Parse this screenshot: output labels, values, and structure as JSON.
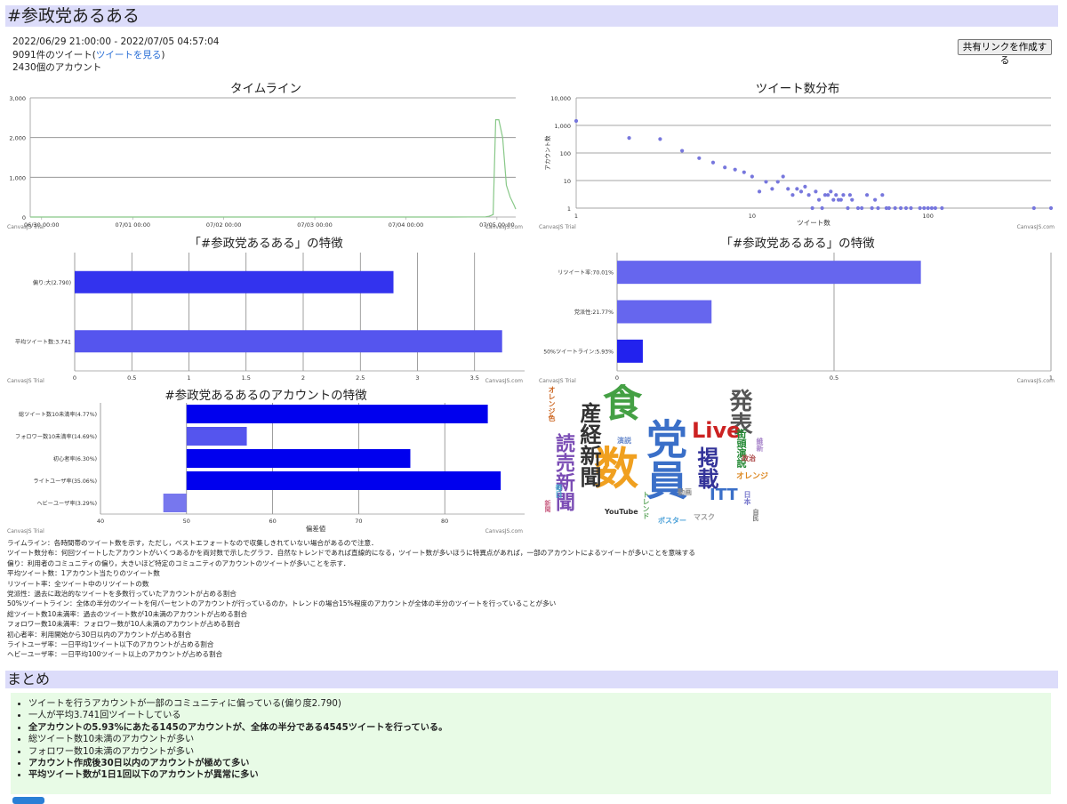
{
  "page": {
    "title": "#参政党あるある",
    "date_range": "2022/06/29 21:00:00 - 2022/07/05 04:57:04",
    "tweet_count_prefix": "9091件のツイート(",
    "tweet_link": "ツイートを見る",
    "tweet_count_suffix": ")",
    "account_count": "2430個のアカウント",
    "share_button": "共有リンクを作成する"
  },
  "trial_label": "CanvasJS Trial",
  "brand_label": "CanvasJS.com",
  "chart_data": [
    {
      "id": "timeline",
      "type": "line",
      "title": "タイムライン",
      "x_ticks": [
        "06/30 00:00",
        "07/01 00:00",
        "07/02 00:00",
        "07/03 00:00",
        "07/04 00:00",
        "07/05 00:00"
      ],
      "y_ticks": [
        "0",
        "1,000",
        "2,000",
        "3,000"
      ],
      "ylim": [
        0,
        3000
      ],
      "grid": true,
      "x": [
        "06/29 21:00",
        "06/30 12:00",
        "07/01 12:00",
        "07/02 12:00",
        "07/03 12:00",
        "07/04 12:00",
        "07/04 21:00",
        "07/04 22:00",
        "07/04 23:00",
        "07/04 23:40",
        "07/05 00:30",
        "07/05 01:30",
        "07/05 02:30",
        "07/05 03:30",
        "07/05 04:30",
        "07/05 04:57"
      ],
      "values": [
        0,
        0,
        0,
        0,
        0,
        0,
        5,
        20,
        60,
        2450,
        2450,
        2000,
        800,
        500,
        300,
        200
      ],
      "color": "#88c888"
    },
    {
      "id": "distribution",
      "type": "scatter",
      "title": "ツイート数分布",
      "xlabel": "ツイート数",
      "ylabel": "アカウント数",
      "x_scale": "log",
      "y_scale": "log",
      "x_ticks": [
        "1",
        "10",
        "100"
      ],
      "y_ticks": [
        "1",
        "10",
        "100",
        "1,000",
        "10,000"
      ],
      "xlim": [
        1,
        500
      ],
      "ylim": [
        1,
        10000
      ],
      "color": "#7777dd",
      "points": [
        [
          1,
          1450
        ],
        [
          2,
          350
        ],
        [
          3,
          320
        ],
        [
          4,
          120
        ],
        [
          5,
          65
        ],
        [
          6,
          45
        ],
        [
          7,
          30
        ],
        [
          8,
          25
        ],
        [
          9,
          20
        ],
        [
          10,
          14
        ],
        [
          11,
          4
        ],
        [
          12,
          9
        ],
        [
          13,
          5
        ],
        [
          14,
          9
        ],
        [
          15,
          14
        ],
        [
          16,
          5
        ],
        [
          17,
          3
        ],
        [
          18,
          5
        ],
        [
          19,
          4
        ],
        [
          20,
          6
        ],
        [
          21,
          3
        ],
        [
          22,
          1
        ],
        [
          23,
          4
        ],
        [
          24,
          2
        ],
        [
          25,
          1
        ],
        [
          26,
          3
        ],
        [
          27,
          3
        ],
        [
          28,
          4
        ],
        [
          29,
          2
        ],
        [
          30,
          3
        ],
        [
          31,
          2
        ],
        [
          32,
          2
        ],
        [
          33,
          3
        ],
        [
          35,
          1
        ],
        [
          36,
          3
        ],
        [
          37,
          2
        ],
        [
          40,
          1
        ],
        [
          42,
          1
        ],
        [
          45,
          3
        ],
        [
          48,
          1
        ],
        [
          50,
          2
        ],
        [
          52,
          1
        ],
        [
          55,
          3
        ],
        [
          58,
          1
        ],
        [
          60,
          1
        ],
        [
          65,
          1
        ],
        [
          70,
          1
        ],
        [
          75,
          1
        ],
        [
          80,
          1
        ],
        [
          90,
          1
        ],
        [
          95,
          1
        ],
        [
          100,
          1
        ],
        [
          105,
          1
        ],
        [
          110,
          1
        ],
        [
          120,
          1
        ],
        [
          400,
          1
        ],
        [
          500,
          1
        ]
      ]
    },
    {
      "id": "features1",
      "type": "bar",
      "orientation": "horizontal",
      "title": "「#参政党あるある」の特徴",
      "categories": [
        "偏り:大(2.790)",
        "平均ツイート数:3.741"
      ],
      "values": [
        2.79,
        3.741
      ],
      "colors": [
        "#3333ee",
        "#5555ee"
      ],
      "xlim": [
        0,
        4
      ],
      "x_ticks": [
        "0",
        "0.5",
        "1",
        "1.5",
        "2",
        "2.5",
        "3",
        "3.5",
        "4"
      ]
    },
    {
      "id": "features2",
      "type": "bar",
      "orientation": "horizontal",
      "title": "「#参政党あるある」の特徴",
      "categories": [
        "リツイート率:70.01%",
        "党派性:21.77%",
        "50%ツイートライン:5.93%"
      ],
      "values": [
        0.7001,
        0.2177,
        0.0593
      ],
      "colors": [
        "#6666ee",
        "#6666ee",
        "#2222ee"
      ],
      "xlim": [
        0,
        1
      ],
      "x_ticks": [
        "0",
        "0.5",
        "1"
      ]
    },
    {
      "id": "accounts",
      "type": "bar",
      "orientation": "horizontal",
      "title": "#参政党あるあるのアカウントの特徴",
      "xlabel": "偏差値",
      "categories": [
        "総ツイート数10未満率(4.77%)",
        "フォロワー数10未満率(14.69%)",
        "初心者率(6.30%)",
        "ライトユーザ率(35.06%)",
        "ヘビーユーザ率(3.29%)"
      ],
      "values": [
        85,
        57,
        76,
        86.5,
        47.3
      ],
      "colors": [
        "#0000ee",
        "#5555ee",
        "#0000ee",
        "#0000ee",
        "#7777ee"
      ],
      "base": 50,
      "xlim": [
        40,
        90
      ],
      "x_ticks": [
        "40",
        "50",
        "60",
        "70",
        "80",
        "90"
      ]
    }
  ],
  "wordcloud": [
    {
      "t": "数",
      "c": "#f0a020",
      "s": 50,
      "x": 58,
      "y": 70,
      "v": false
    },
    {
      "t": "党員",
      "c": "#3a6fc8",
      "s": 46,
      "x": 114,
      "y": 38,
      "v": true
    },
    {
      "t": "食",
      "c": "#44a044",
      "s": 44,
      "x": 68,
      "y": 0,
      "v": false
    },
    {
      "t": "産経新聞",
      "c": "#333333",
      "s": 24,
      "x": 40,
      "y": 20,
      "v": true
    },
    {
      "t": "読売新聞",
      "c": "#7b4db5",
      "s": 22,
      "x": 12,
      "y": 55,
      "v": true
    },
    {
      "t": "発表",
      "c": "#555555",
      "s": 26,
      "x": 208,
      "y": 5,
      "v": true
    },
    {
      "t": "掲載",
      "c": "#333399",
      "s": 24,
      "x": 172,
      "y": 70,
      "v": true
    },
    {
      "t": "Live",
      "c": "#cc2222",
      "s": 24,
      "x": 168,
      "y": 40,
      "v": false
    },
    {
      "t": "ITT",
      "c": "#3a6fc8",
      "s": 18,
      "x": 188,
      "y": 116,
      "v": false
    },
    {
      "t": "街頭演説",
      "c": "#228833",
      "s": 11,
      "x": 218,
      "y": 50,
      "v": true
    },
    {
      "t": "オレンジ",
      "c": "#dd8822",
      "s": 9,
      "x": 218,
      "y": 100,
      "v": false
    },
    {
      "t": "YouTube",
      "c": "#333333",
      "s": 8,
      "x": 70,
      "y": 140,
      "v": false
    },
    {
      "t": "動画",
      "c": "#888888",
      "s": 8,
      "x": 152,
      "y": 118,
      "v": false
    },
    {
      "t": "マスク",
      "c": "#999999",
      "s": 8,
      "x": 170,
      "y": 146,
      "v": false
    },
    {
      "t": "ポスター",
      "c": "#4aa0d8",
      "s": 8,
      "x": 130,
      "y": 150,
      "v": false
    },
    {
      "t": "トレンド",
      "c": "#66aa66",
      "s": 8,
      "x": 112,
      "y": 120,
      "v": true
    },
    {
      "t": "オレンジ色",
      "c": "#cc6622",
      "s": 8,
      "x": 6,
      "y": 2,
      "v": true
    },
    {
      "t": "政治",
      "c": "#aa4444",
      "s": 8,
      "x": 224,
      "y": 80,
      "v": false
    },
    {
      "t": "日本",
      "c": "#7777cc",
      "s": 8,
      "x": 226,
      "y": 120,
      "v": true
    },
    {
      "t": "維新",
      "c": "#aa88cc",
      "s": 8,
      "x": 240,
      "y": 60,
      "v": true
    },
    {
      "t": "自民",
      "c": "#777777",
      "s": 7,
      "x": 236,
      "y": 140,
      "v": true
    },
    {
      "t": "演説",
      "c": "#6688cc",
      "s": 8,
      "x": 84,
      "y": 60,
      "v": false
    },
    {
      "t": "毎日",
      "c": "#44aacc",
      "s": 8,
      "x": 14,
      "y": 112,
      "v": true
    },
    {
      "t": "新聞",
      "c": "#cc6688",
      "s": 7,
      "x": 2,
      "y": 130,
      "v": true
    }
  ],
  "descriptions": [
    "ライムライン：各時間帯のツイート数を示す，ただし，ベストエフォートなので収集しきれていない場合があるので注意．",
    "ツイート数分布：何回ツイートしたアカウントがいくつあるかを両対数で示したグラフ．自然なトレンドであれば直線的になる，ツイート数が多いほうに特異点があれば，一部のアカウントによるツイートが多いことを意味する",
    "偏り：利用者のコミュニティの偏り，大きいほど特定のコミュニティのアカウントのツイートが多いことを示す．",
    "平均ツイート数：1アカウント当たりのツイート数",
    "リツイート率：全ツイート中のリツイートの数",
    "党派性：過去に政治的なツイートを多数行っていたアカウントが占める割合",
    "50%ツイートライン：全体の半分のツイートを何パーセントのアカウントが行っているのか，トレンドの場合15%程度のアカウントが全体の半分のツイートを行っていることが多い",
    "総ツイート数10未満率：過去のツイート数が10未満のアカウントが占める割合",
    "フォロワー数10未満率：フォロワー数が10人未満のアカウントが占める割合",
    "初心者率：利用開始から30日以内のアカウントが占める割合",
    "ライトユーザ率：一日平均1ツイート以下のアカウントが占める割合",
    "ヘビーユーザ率：一日平均100ツイート以上のアカウントが占める割合"
  ],
  "summary": {
    "heading": "まとめ",
    "items": [
      {
        "text": "ツイートを行うアカウントが一部のコミュニティに偏っている(偏り度2.790)",
        "bold": false
      },
      {
        "text": "一人が平均3.741回ツイートしている",
        "bold": false
      },
      {
        "text": "全アカウントの5.93%にあたる145のアカウントが、全体の半分である4545ツイートを行っている。",
        "bold": true
      },
      {
        "text": "総ツイート数10未満のアカウントが多い",
        "bold": false
      },
      {
        "text": "フォロワー数10未満のアカウントが多い",
        "bold": false
      },
      {
        "text": "アカウント作成後30日以内のアカウントが極めて多い",
        "bold": true
      },
      {
        "text": "平均ツイート数が1日1回以下のアカウントが異常に多い",
        "bold": true
      }
    ]
  }
}
